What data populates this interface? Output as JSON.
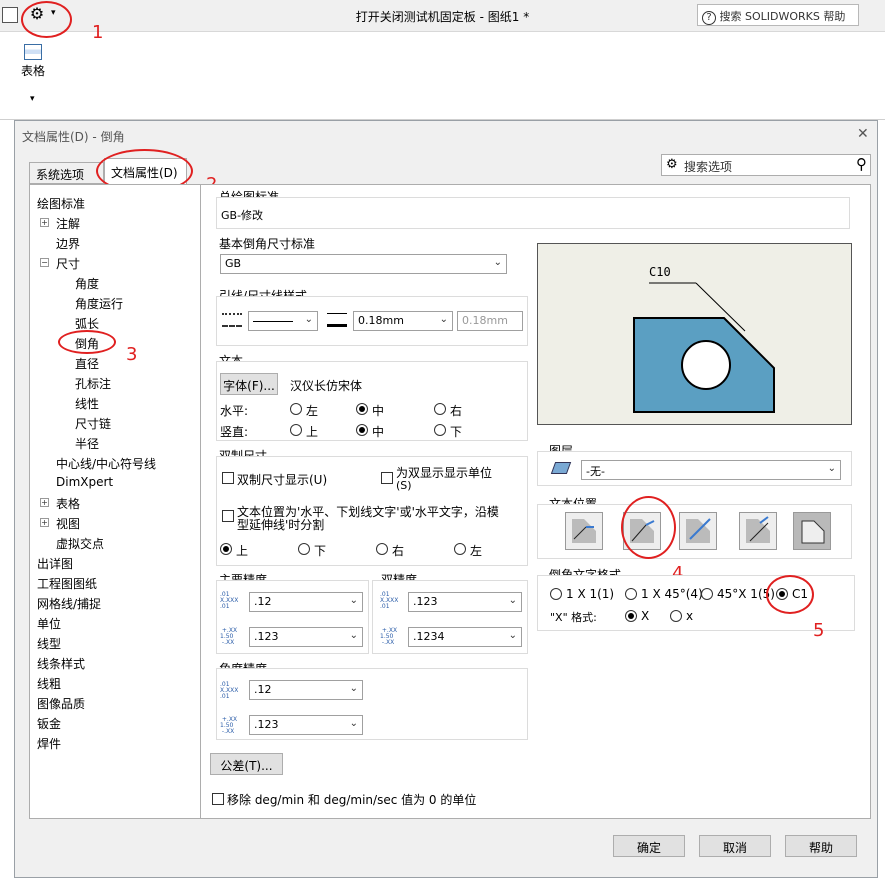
{
  "app": {
    "title": "打开关闭测试机固定板 - 图纸1 *",
    "search_placeholder": "搜索 SOLIDWORKS 帮助",
    "ribbon_table_label": "表格"
  },
  "dialog": {
    "title": "文档属性(D) - 倒角",
    "tabs": [
      "系统选项(S)",
      "文档属性(D)"
    ],
    "search_label": "搜索选项",
    "tree": [
      "绘图标准",
      "注解",
      "边界",
      "尺寸",
      "角度",
      "角度运行",
      "弧长",
      "倒角",
      "直径",
      "孔标注",
      "线性",
      "尺寸链",
      "半径",
      "中心线/中心符号线",
      "DimXpert",
      "表格",
      "视图",
      "虚拟交点",
      "出详图",
      "工程图图纸",
      "网格线/捕捉",
      "单位",
      "线型",
      "线条样式",
      "线粗",
      "图像品质",
      "钣金",
      "焊件"
    ],
    "overall_standard": {
      "label": "总绘图标准",
      "value": "GB-修改"
    },
    "base_standard": {
      "label": "基本倒角尺寸标准",
      "value": "GB"
    },
    "leader_style": {
      "label": "引线/尺寸线样式",
      "thickness": "0.18mm",
      "custom": "0.18mm"
    },
    "text": {
      "label": "文本",
      "font_button": "字体(F)...",
      "font_name": "汉仪长仿宋体",
      "horizontal_label": "水平:",
      "horizontal_options": [
        "左",
        "中",
        "右"
      ],
      "horizontal_selected": "中",
      "vertical_label": "竖直:",
      "vertical_options": [
        "上",
        "中",
        "下"
      ],
      "vertical_selected": "中"
    },
    "dual": {
      "label": "双制尺寸",
      "show_dual": "双制尺寸显示(U)",
      "show_units": "为双显示显示单位",
      "show_units_key": "(S)",
      "split_line1": "文本位置为'水平、下划线文字'或'水平文字，沿模",
      "split_line2": "型延伸线'时分割",
      "positions": [
        "上",
        "下",
        "右",
        "左"
      ],
      "position_selected": "上"
    },
    "primary_precision": {
      "label": "主要精度",
      "value1": ".12",
      "value2": ".123"
    },
    "dual_precision": {
      "label": "双精度",
      "value1": ".123",
      "value2": ".1234"
    },
    "angle_precision": {
      "label": "角度精度",
      "value1": ".12",
      "value2": ".123"
    },
    "tolerance_button": "公差(T)...",
    "remove_units": "移除 deg/min 和 deg/min/sec 值为 0 的单位",
    "preview_label": "C10",
    "layer": {
      "label": "图层",
      "value": "-无-"
    },
    "text_position": {
      "label": "文本位置"
    },
    "chamfer_format": {
      "label": "倒角文字格式",
      "options": [
        "1 X 1(1)",
        "1 X 45°(4)",
        "45°X 1(5)",
        "C1"
      ],
      "selected": "C1",
      "x_format_label": "\"X\" 格式:",
      "x_options": [
        "X",
        "x"
      ],
      "x_selected": "X"
    },
    "buttons": {
      "ok": "确定",
      "cancel": "取消",
      "help": "帮助"
    }
  },
  "annotations": [
    "1",
    "2",
    "3",
    "4",
    "5"
  ],
  "colors": {
    "preview_bg": "#efefe7",
    "part_fill": "#5b9fc2",
    "annotation": "#e02020"
  }
}
